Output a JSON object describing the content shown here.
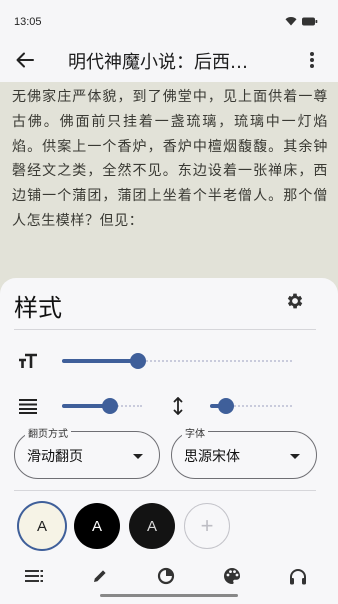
{
  "status_bar": {
    "time": "13:05"
  },
  "app_bar": {
    "title": "明代神魔小说：后西…"
  },
  "reader": {
    "text": "无佛家庄严体貌，到了佛堂中，见上面供着一尊古佛。佛面前只挂着一盏琉璃，琉璃中一灯焰焰。供案上一个香炉，香炉中檀烟馥馥。其余钟磬经文之类，全然不见。东边设着一张禅床，西边铺一个蒲团，蒲团上坐着个半老僧人。那个僧人怎生模样？但见："
  },
  "style_sheet": {
    "title": "样式",
    "font_size_level": 0.33,
    "line_spacing_level": 0.6,
    "paragraph_spacing_level": 0.2,
    "page_turn": {
      "label": "翻页方式",
      "value": "滑动翻页"
    },
    "font": {
      "label": "字体",
      "value": "思源宋体"
    },
    "themes": [
      {
        "letter": "A",
        "bg": "#f6f3e6",
        "fg": "#222222",
        "selected": true
      },
      {
        "letter": "A",
        "bg": "#000000",
        "fg": "#ffffff",
        "selected": false
      },
      {
        "letter": "A",
        "bg": "#131313",
        "fg": "#d9d9d9",
        "selected": false
      }
    ],
    "add_theme_symbol": "+"
  },
  "colors": {
    "accent": "#3f5f9a",
    "sheet_bg": "#f7f7f9",
    "page_bg": "#e2e2d8"
  }
}
